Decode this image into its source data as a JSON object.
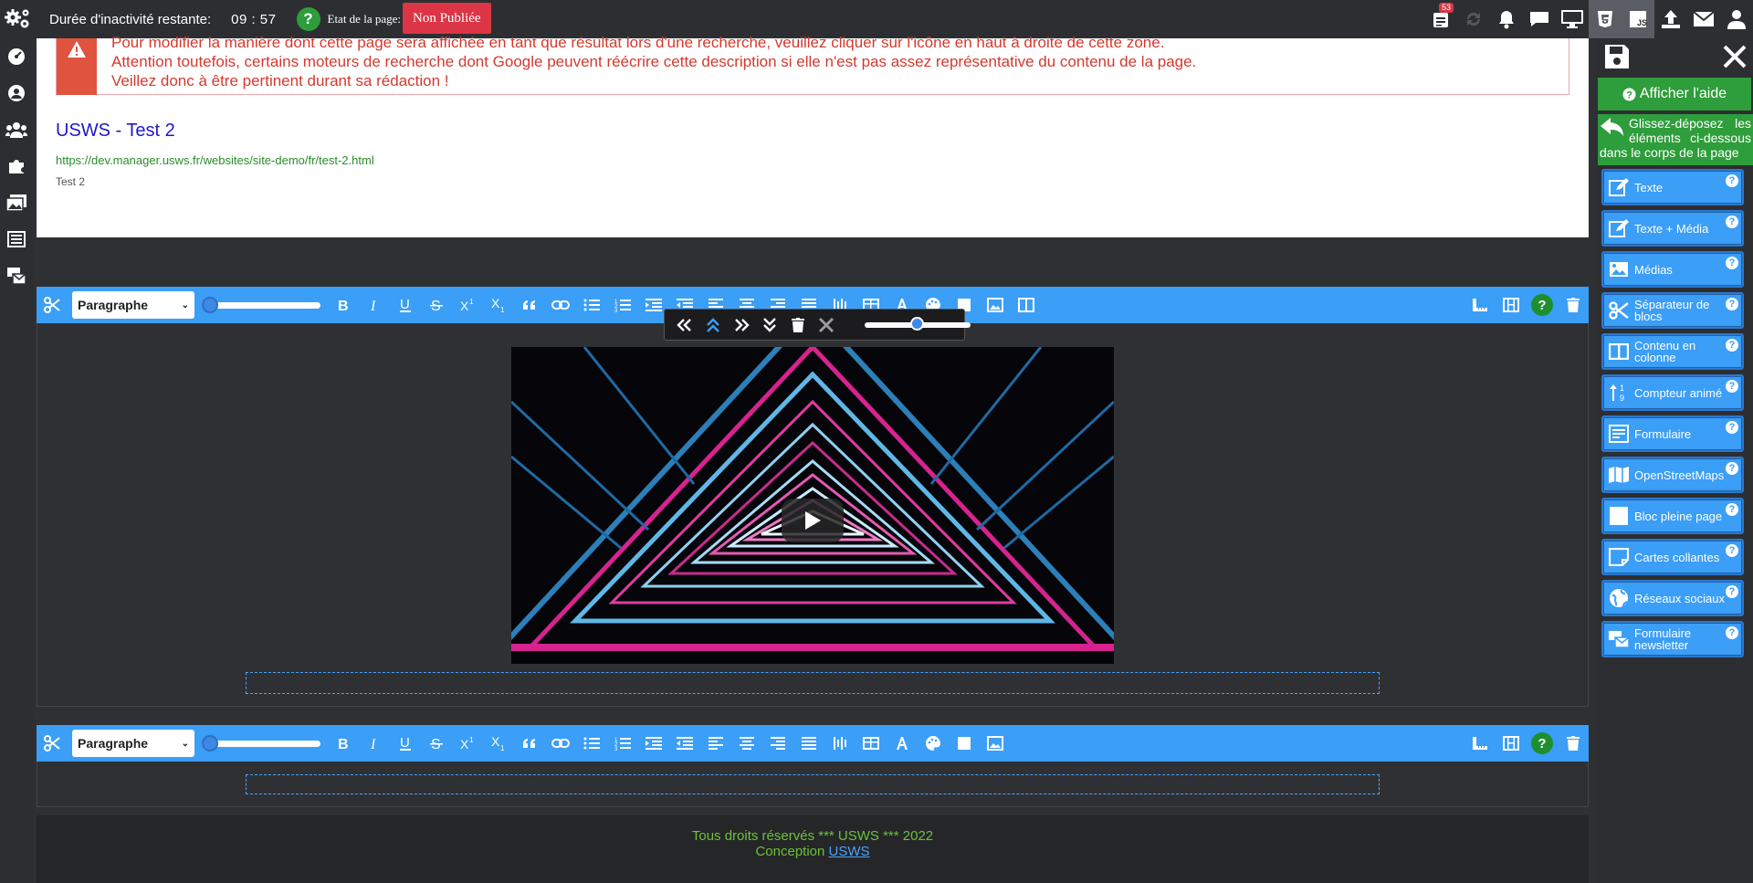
{
  "topbar": {
    "timer_label": "Durée d'inactivité restante:",
    "timer_value": "09 : 57",
    "etat_label": "Etat de la page:",
    "status": "Non Publiée",
    "notif_count": "53"
  },
  "seo": {
    "alert_lines": [
      "Pour modifier la manière dont cette page sera affichée en tant que résultat lors d'une recherche, veuillez cliquer sur l'icône en haut à droite de cette zone.",
      "Attention toutefois, certains moteurs de recherche dont Google peuvent réécrire cette description si elle n'est pas assez représentative du contenu de la page.",
      "Veillez donc à être pertinent durant sa rédaction !"
    ],
    "title": "USWS - Test 2",
    "url": "https://dev.manager.usws.fr/websites/site-demo/fr/test-2.html",
    "description": "Test 2"
  },
  "editor": {
    "paragraph_select": "Paragraphe",
    "paragraph_select_2": "Paragraphe"
  },
  "footer": {
    "line1": "Tous droits réservés *** USWS *** 2022",
    "line2_prefix": "Conception",
    "line2_link": "USWS"
  },
  "panel": {
    "help_button": "Afficher l'aide",
    "drag_text": "Glissez-déposez les éléments ci-dessous dans le corps de la page",
    "items": [
      {
        "label": "Texte",
        "icon": "edit-icon"
      },
      {
        "label": "Texte + Média",
        "icon": "edit-icon"
      },
      {
        "label": "Médias",
        "icon": "image-icon"
      },
      {
        "label": "Séparateur de blocs",
        "icon": "scissors-icon"
      },
      {
        "label": "Contenu en colonne",
        "icon": "columns-icon"
      },
      {
        "label": "Compteur animé",
        "icon": "sort-numeric-icon"
      },
      {
        "label": "Formulaire",
        "icon": "form-icon"
      },
      {
        "label": "OpenStreetMaps",
        "icon": "map-icon"
      },
      {
        "label": "Bloc pleine page",
        "icon": "square-icon"
      },
      {
        "label": "Cartes collantes",
        "icon": "sticky-note-icon"
      },
      {
        "label": "Réseaux sociaux",
        "icon": "globe-icon"
      },
      {
        "label": "Formulaire newsletter",
        "icon": "newsletter-icon"
      }
    ]
  },
  "colors": {
    "toolbar_blue": "#3b9ef7",
    "status_red": "#dc3545",
    "help_green": "#2e9d3b"
  }
}
